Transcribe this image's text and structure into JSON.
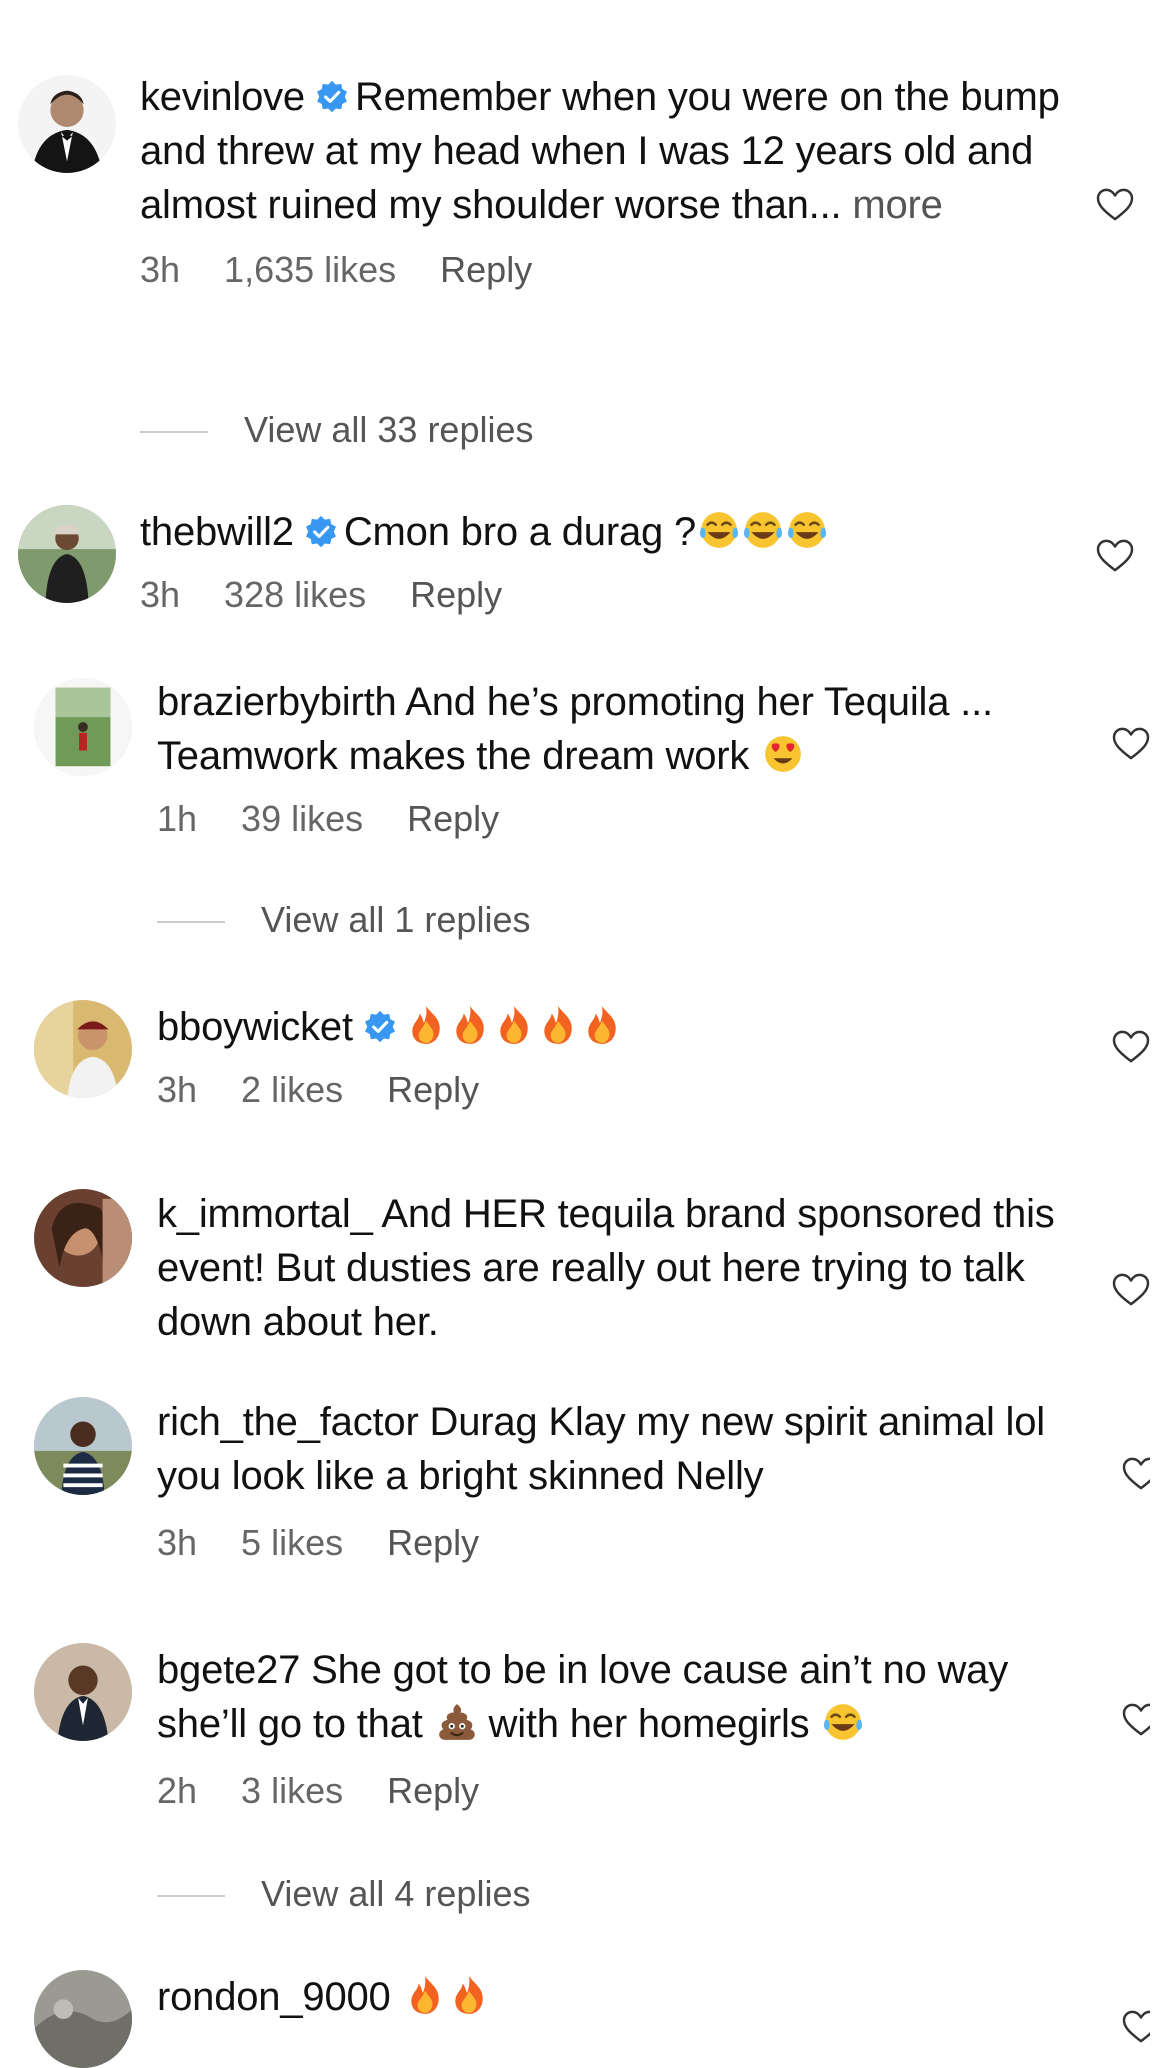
{
  "comments": [
    {
      "username": "kevinlove",
      "verified": true,
      "text": "Remember when you were on the bump and threw at my head when I was 12 years old and almost ruined my shoulder worse than...",
      "more_label": "more",
      "time": "3h",
      "likes": "1,635 likes",
      "reply_label": "Reply",
      "view_replies": "View all 33 replies"
    },
    {
      "username": "thebwill2",
      "verified": true,
      "text": "Cmon bro a durag ?",
      "emojis": [
        "tears-of-joy",
        "tears-of-joy",
        "tears-of-joy"
      ],
      "time": "3h",
      "likes": "328 likes",
      "reply_label": "Reply"
    },
    {
      "username": "brazierbybirth",
      "verified": false,
      "text": "And he’s promoting her Tequila ... Teamwork makes the dream work",
      "emojis": [
        "heart-eyes"
      ],
      "time": "1h",
      "likes": "39 likes",
      "reply_label": "Reply",
      "view_replies": "View all 1 replies"
    },
    {
      "username": "bboywicket",
      "verified": true,
      "text": "",
      "emojis": [
        "fire",
        "fire",
        "fire",
        "fire",
        "fire"
      ],
      "time": "3h",
      "likes": "2 likes",
      "reply_label": "Reply"
    },
    {
      "username": "k_immortal_",
      "verified": false,
      "text": "And HER tequila brand sponsored this event! But dusties are really out here trying to talk down about her."
    },
    {
      "username": "rich_the_factor",
      "verified": false,
      "text": "Durag Klay my new spirit animal lol you look like a bright skinned Nelly",
      "time": "3h",
      "likes": "5 likes",
      "reply_label": "Reply"
    },
    {
      "username": "bgete27",
      "verified": false,
      "text_before": "She got to be in love cause ain’t no way she’ll go to that",
      "text_after": "with her homegirls",
      "emojis": [
        "poop",
        "tears-of-joy"
      ],
      "time": "2h",
      "likes": "3 likes",
      "reply_label": "Reply",
      "view_replies": "View all 4 replies"
    },
    {
      "username": "rondon_9000",
      "verified": false,
      "text": "",
      "emojis": [
        "fire",
        "fire"
      ]
    }
  ],
  "colors": {
    "verified": "#3897f0",
    "meta": "#666666",
    "text": "#111111"
  }
}
